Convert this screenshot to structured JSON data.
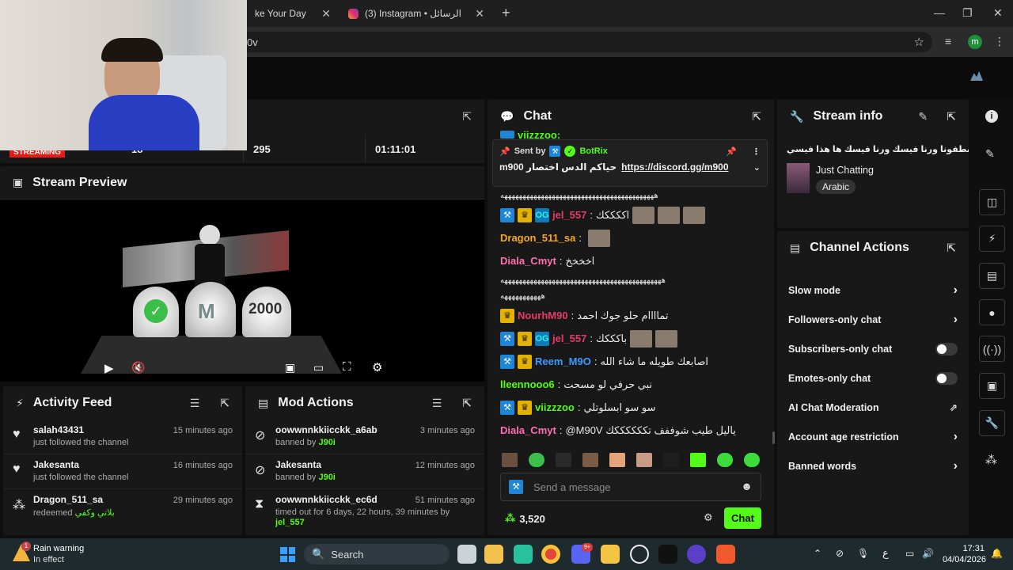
{
  "browser": {
    "tabs": [
      {
        "label": "ke Your Day",
        "active": false
      },
      {
        "label": "(3) Instagram • الرسائل",
        "active": false
      }
    ],
    "new_tab": "+",
    "address": "0v",
    "profile_initial": "m"
  },
  "stats": {
    "status_badge": "STREAMING",
    "viewers": "18",
    "followers": "295",
    "uptime": "01:11:01"
  },
  "preview": {
    "title": "Stream Preview",
    "graphic_number": "2000"
  },
  "activity": {
    "title": "Activity Feed",
    "items": [
      {
        "user": "salah43431",
        "action": "just followed the channel",
        "time": "15 minutes ago",
        "icon": "heart-icon"
      },
      {
        "user": "Jakesanta",
        "action": "just followed the channel",
        "time": "16 minutes ago",
        "icon": "heart-icon"
      },
      {
        "user": "Dragon_511_sa",
        "action": "redeemed",
        "extra": "بلاتي وكفي",
        "time": "29 minutes ago",
        "icon": "reward-icon"
      }
    ]
  },
  "mod": {
    "title": "Mod Actions",
    "items": [
      {
        "user": "oowwnnkkiicckk_a6ab",
        "action": "banned by",
        "by": "J90i",
        "time": "3 minutes ago"
      },
      {
        "user": "Jakesanta",
        "action": "banned by",
        "by": "J90i",
        "time": "12 minutes ago"
      },
      {
        "user": "oowwnnkkiicckk_ec6d",
        "action": "timed out for 6 days, 22 hours, 39 minutes by",
        "by": "jel_557",
        "time": "51 minutes ago"
      }
    ]
  },
  "chat": {
    "title": "Chat",
    "top_partial": "viizzzoo:",
    "pinned": {
      "label": "Sent by",
      "sender": "BotRix",
      "text": "m900 حياكم الدس اختصار",
      "link": "https://discord.gg/m900"
    },
    "messages": [
      {
        "user": "",
        "color": "#e8e8e8",
        "badges": [],
        "text": "ههههههههههههههههههههههههههههههههههههههههههه",
        "emotes": 0
      },
      {
        "user": "jel_557",
        "color": "#e9396a",
        "badges": [
          "mod",
          "crown",
          "og"
        ],
        "text": "اككككك",
        "emotes": 3
      },
      {
        "user": "Dragon_511_sa",
        "color": "#f5a623",
        "badges": [],
        "text": "",
        "emotes": 1
      },
      {
        "user": "Diala_Cmyt",
        "color": "#ff6fb0",
        "badges": [],
        "text": "اخخخخ",
        "emotes": 0
      },
      {
        "user": "",
        "color": "#e8e8e8",
        "badges": [],
        "text": "ههههههههههههههههههههههههههههههههههههههههههههه",
        "emotes": 0
      },
      {
        "user": "",
        "color": "#e8e8e8",
        "badges": [],
        "text": "هههههههههههه",
        "emotes": 0
      },
      {
        "user": "NourhM90",
        "color": "#e9396a",
        "badges": [
          "crown"
        ],
        "text": "تماااام حلو جوك احمد",
        "emotes": 0
      },
      {
        "user": "jel_557",
        "color": "#e9396a",
        "badges": [
          "mod",
          "crown",
          "og"
        ],
        "text": "باكككك",
        "emotes": 2
      },
      {
        "user": "Reem_M9O",
        "color": "#3a9bff",
        "badges": [
          "mod",
          "crown"
        ],
        "text": "اصابعك طويله ما شاء الله",
        "emotes": 0
      },
      {
        "user": "lleennooo6",
        "color": "#53fc18",
        "badges": [],
        "text": "نبي حرفي لو مسحت",
        "emotes": 0
      },
      {
        "user": "viizzzoo",
        "color": "#53fc18",
        "badges": [
          "mod",
          "crown"
        ],
        "text": "سو سو ابسلوتلي",
        "emotes": 0
      },
      {
        "user": "Diala_Cmyt",
        "color": "#ff6fb0",
        "badges": [],
        "text": "@M90V ياليل طيب شوففف تككككككك",
        "emotes": 0
      }
    ],
    "input_placeholder": "Send a message",
    "points": "3,520",
    "send_label": "Chat"
  },
  "stream_info": {
    "title_label": "Stream info",
    "stream_title": "اشطفونا ورنا فيسك ورنا فيسك ها هذا فيسي",
    "category": "Just Chatting",
    "language": "Arabic"
  },
  "channel_actions": {
    "title": "Channel Actions",
    "items": [
      {
        "label": "Slow mode",
        "control": "chevron"
      },
      {
        "label": "Followers-only chat",
        "control": "chevron"
      },
      {
        "label": "Subscribers-only chat",
        "control": "toggle"
      },
      {
        "label": "Emotes-only chat",
        "control": "toggle"
      },
      {
        "label": "AI Chat Moderation",
        "control": "external"
      },
      {
        "label": "Account age restriction",
        "control": "chevron"
      },
      {
        "label": "Banned words",
        "control": "chevron"
      }
    ]
  },
  "taskbar": {
    "weather_title": "Rain warning",
    "weather_sub": "In effect",
    "search": "Search",
    "time": "17:31",
    "date": "04/04/2026",
    "lang": "ع",
    "weather_badge": "1",
    "discord_badge": "9+"
  },
  "colors": {
    "brand_green": "#53fc18",
    "panel": "#181818",
    "streaming_red": "#e91916"
  }
}
